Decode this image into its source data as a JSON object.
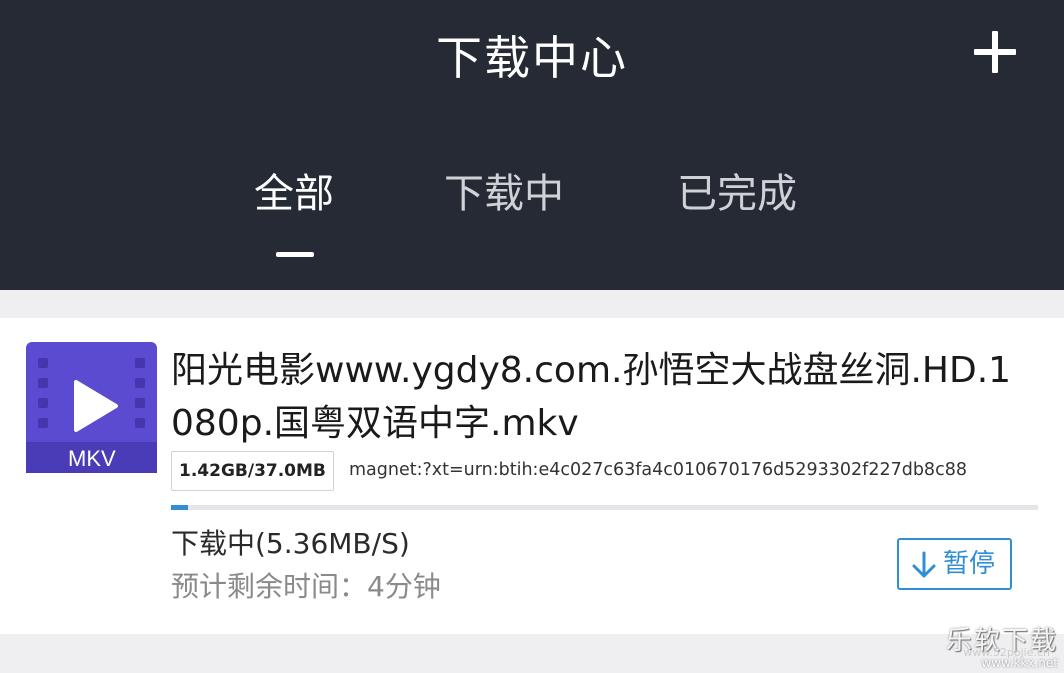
{
  "header": {
    "title": "下载中心",
    "add_icon": "plus-icon",
    "tabs": [
      {
        "label": "全部",
        "active": true
      },
      {
        "label": "下载中",
        "active": false
      },
      {
        "label": "已完成",
        "active": false
      }
    ]
  },
  "download_item": {
    "file_type": "MKV",
    "file_icon": "video-file-icon",
    "file_name": "阳光电影www.ygdy8.com.孙悟空大战盘丝洞.HD.1080p.国粤双语中字.mkv",
    "size_text": "1.42GB/37.0MB",
    "magnet": "magnet:?xt=urn:btih:e4c027c63fa4c010670176d5293302f227db8c88",
    "progress": 0.02,
    "status": "下载中(5.36MB/S)",
    "eta": "预计剩余时间：4分钟",
    "pause_label": "暂停",
    "pause_icon": "arrow-down-icon"
  },
  "watermark": {
    "text": "乐软下载",
    "url1": "www.52pojie.cn",
    "url2": "www.kkx.net"
  },
  "colors": {
    "header_bg": "#252a34",
    "accent": "#2f8ed6",
    "icon_bg": "#5a4bd0"
  }
}
